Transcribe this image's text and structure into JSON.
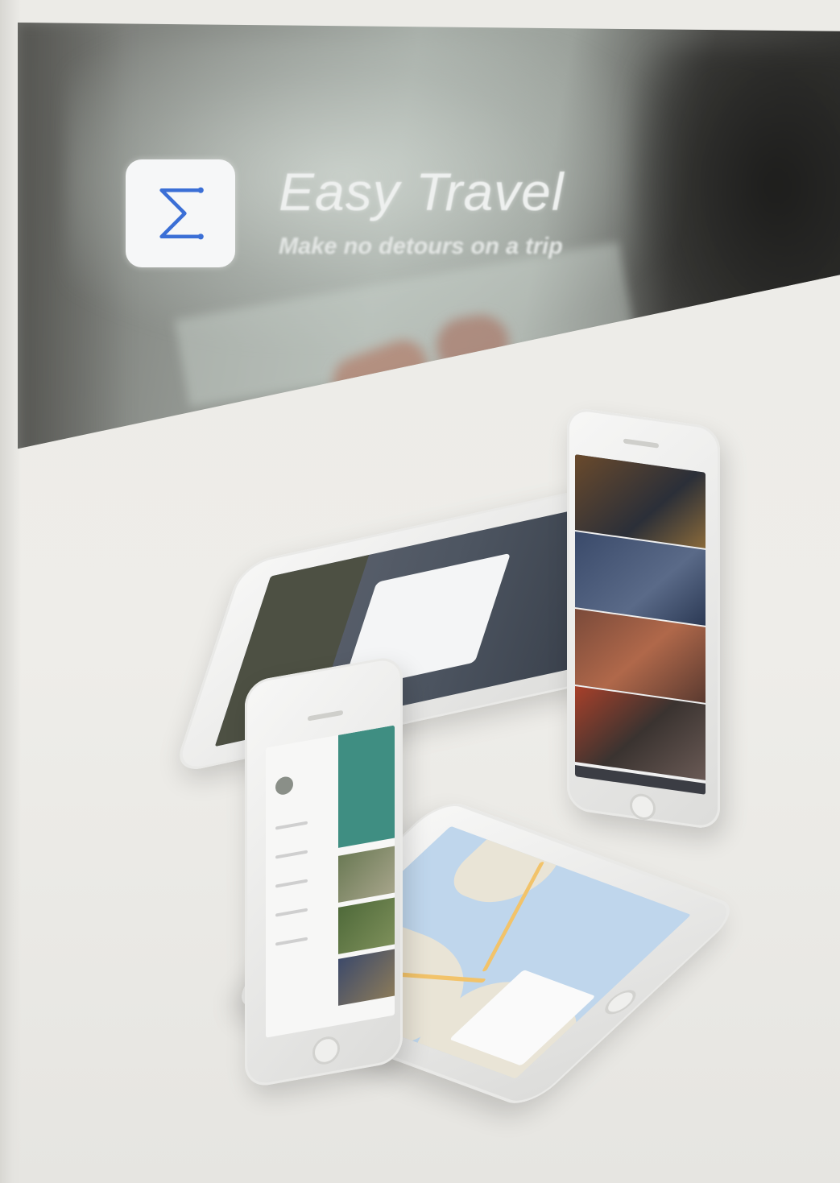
{
  "banner": {
    "app_title": "Easy Travel",
    "tagline": "Make no detours on a trip"
  },
  "app_icon": {
    "icon": "sigma-route-icon",
    "glyph": "Σ",
    "color": "#3b6fd6",
    "background": "#f6f7f8"
  },
  "colors": {
    "page_background": "#ebeae6",
    "banner_dark": "#2d2d2b",
    "map_water": "#bfd6ec",
    "teal_accent": "#3f8e82"
  },
  "phones": [
    {
      "name": "phone-lying-back",
      "screen": "travel card screen"
    },
    {
      "name": "phone-standing-right",
      "screen": "destination photo list"
    },
    {
      "name": "phone-lying-map",
      "screen": "map screen"
    },
    {
      "name": "phone-standing-front",
      "screen": "side menu screen"
    }
  ]
}
